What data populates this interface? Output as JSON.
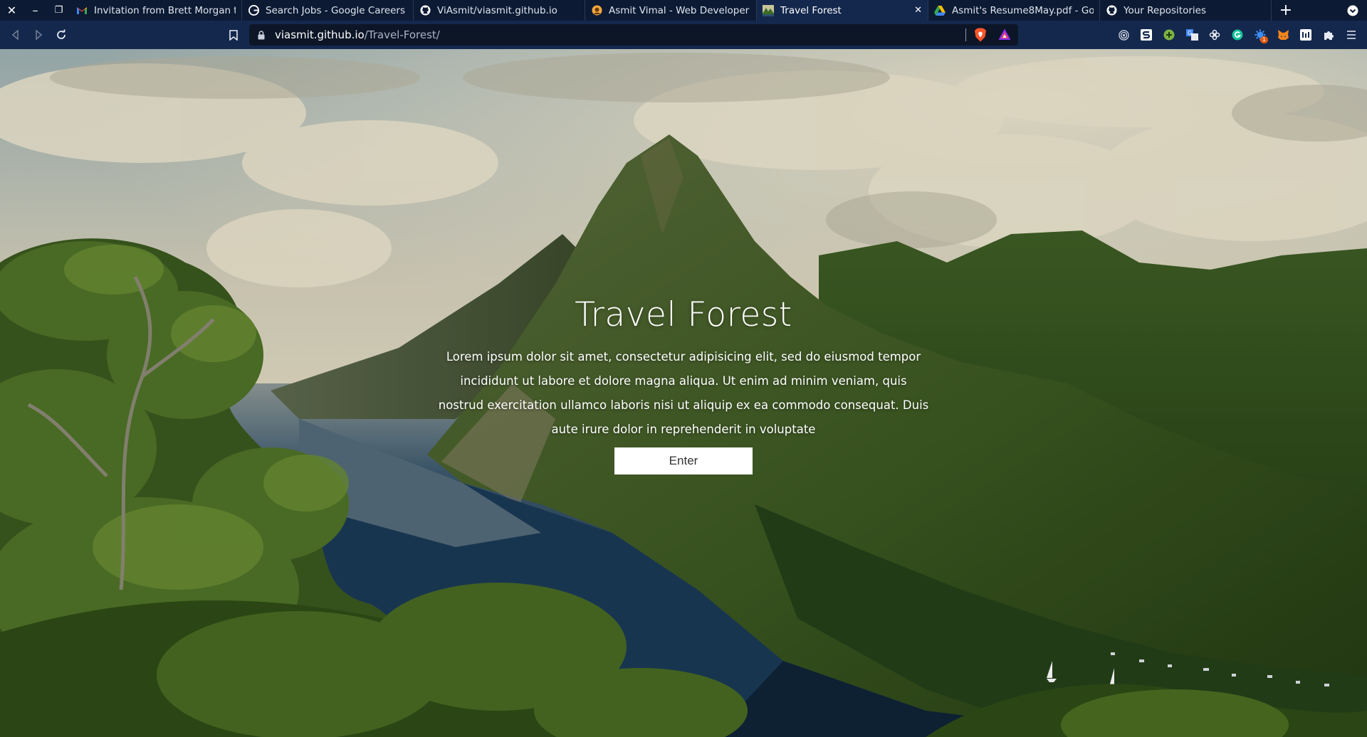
{
  "window_controls": {
    "close": "✕",
    "minimize": "–",
    "restore": "❐"
  },
  "tabs": [
    {
      "title": "Invitation from Brett Morgan to",
      "favicon": "gmail-icon",
      "active": false
    },
    {
      "title": "Search Jobs - Google Careers",
      "favicon": "google-icon",
      "active": false
    },
    {
      "title": "ViAsmit/viasmit.github.io",
      "favicon": "github-icon",
      "active": false
    },
    {
      "title": "Asmit Vimal - Web Developer",
      "favicon": "portfolio-icon",
      "active": false
    },
    {
      "title": "Travel Forest",
      "favicon": "travel-forest-icon",
      "active": true,
      "close": "✕"
    },
    {
      "title": "Asmit's Resume8May.pdf - Goo",
      "favicon": "google-drive-icon",
      "active": false
    },
    {
      "title": "Your Repositories",
      "favicon": "github-icon",
      "active": false
    }
  ],
  "new_tab": "+",
  "address_bar": {
    "host": "viasmit.github.io",
    "path": "/Travel-Forest/"
  },
  "extensions": [
    "tor-icon",
    "s-extension-icon",
    "green-plus-icon",
    "translate-icon",
    "flower-icon",
    "grammarly-icon",
    "gear-bug-icon",
    "metamask-icon",
    "reader-icon",
    "puzzle-icon",
    "menu-icon"
  ],
  "extension_badge": "1",
  "hero": {
    "title": "Travel Forest",
    "description": "Lorem ipsum dolor sit amet, consectetur adipisicing elit, sed do eiusmod tempor incididunt ut labore et dolore magna aliqua. Ut enim ad minim veniam, quis nostrud exercitation ullamco laboris nisi ut aliquip ex ea commodo consequat. Duis aute irure dolor in reprehenderit in voluptate",
    "button_label": "Enter"
  },
  "colors": {
    "tabstrip": "#0c1a33",
    "toolbar": "#14284d",
    "urlbar": "#0d1627",
    "sky": "#cfd2c6",
    "water": "#1e3a55",
    "forest": "#2f4a1c"
  }
}
